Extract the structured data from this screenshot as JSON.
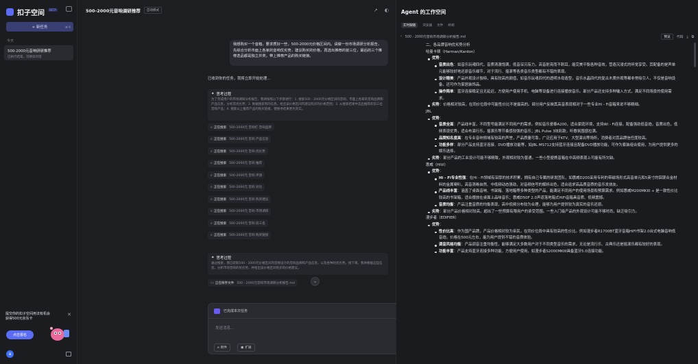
{
  "sidebar": {
    "app_name": "扣子空间",
    "beta": "BETA",
    "new_task": "+ 新任务",
    "new_task_kbd": "⌘ K",
    "section_today": "今天",
    "task_title": "500-2000元音响研研推荐",
    "task_subtitle": "已执行结束，可继续对话",
    "promo_text": "提交你的扣子空间用法有机会获得500元京东卡",
    "promo_button": "点击报名",
    "avatar": "a"
  },
  "chat": {
    "title": "500-2000元音响调研推荐",
    "mode_badge": "自动模式",
    "user_message": "我想购买一个音箱，要求质好一些，500-2000元价格区间内。请做一份市场调研分析报告，先综合分析市面上各家的音响优劣势，建议购买的价格，再选出推荐的前三位，最后的三个推荐选品都是独立并类，带上推荐产品的购买链接。",
    "reply": "已收到你的任务，我将立即开始处理...",
    "think1_title": "思考过程",
    "think1_body": "为了完成用户的市场调研分析报告，我将按照以下步骤进行：1. 搜索500 - 2000元价格区间的音响，市面上各家的音响品牌和产品信息，分析其优劣势；2. 根据搜索到的信息，给出该价格区间内建议购买的价格范围；3. 从搜索结果中选出推荐的前三位音响产品；4. 搜索以上推荐产品的购买链接，使搜寻结果更为充实。",
    "search_label": "正在搜索",
    "searches": [
      "500-2000元 音响打 音响品牌",
      "500-2000元 音响 产品信息",
      "500-2000元 音响 优劣势",
      "500-2000元 音响 推荐",
      "500-2000元 音响 评测",
      "500-2000元 音响 对比",
      "500-2000元 音响 购买建议",
      "500-2000元 音响 市场调研",
      "500-2000元 音响 前三名",
      "500-2000元 音响 购买链接"
    ],
    "think2_title": "思考过程",
    "think2_body": "通过搜索，我已获取500 - 2000元价格区间内音频设计的音响品牌和产品信息，以及各种的优劣势。接下来，我将根据这些信息，分析市场音响的优劣势，并给出该价格区间购买的价格建议。",
    "save_label": "正在保存文件",
    "save_file": "500 - 2000元音响市场调研分析报告.md",
    "status": "已完成本次任务",
    "input_placeholder": "发送消息...",
    "attach_label": "附件",
    "extend_label": "扩展"
  },
  "agent": {
    "title": "Agent 的工作空间",
    "tabs": [
      "实时跟随",
      "浏览器",
      "文件",
      "终端"
    ],
    "file_name": "500 - 2000元音响市场调研分析报告.md",
    "preview_label": "预览",
    "code_label": "代码",
    "doc": [
      {
        "lv": 0,
        "t": "二、各品牌音响优劣势分析"
      },
      {
        "lv": 0,
        "t": "哈曼卡顿（Harman/Kardon）"
      },
      {
        "lv": 1,
        "b": "优势",
        "t": "："
      },
      {
        "lv": 2,
        "b": "音质出色",
        "t": "：如音乐玩魂四代，音质清澈饱满，低音深沉有力，高音射亮而不刺耳，能完美平衡各种音效，营造沉浸式的听觉享受。其配备的是声单元能够较好地还原音乐细节，对于流行、摇滚等各类音乐类型都有不错的表现。"
      },
      {
        "lv": 2,
        "b": "设计精美",
        "t": "：产品外观设计独特，具有较高的颜值，如音乐玩魂四代的透明水母造型，音乐水晶四代的复古木质外观等都非常吸引人，不仅是音响设备，还可作为家居装饰品。"
      },
      {
        "lv": 2,
        "b": "操作简单",
        "t": "：蓝牙连接稳定且无延迟，方便用户使用手机、电脑等设备进行连接播放音乐。部分产品还支持多种输入方式，满足不同场景的使用需求。"
      },
      {
        "lv": 1,
        "b": "劣势",
        "t": "：价格相对较高，在同价位段中可能性价比不是最高的。部分用户反映其高音表现相对于一些专业Hi - Fi音箱来说不够精细。"
      },
      {
        "lv": 0,
        "t": "JBL"
      },
      {
        "lv": 1,
        "b": "优势",
        "t": "："
      },
      {
        "lv": 2,
        "b": "音质全面",
        "t": "：产品线丰富，不同型号能满足不同用户的需求。例如音乐瓷泰A200，适合家庭环境，支持Wi - Fi连接，配备强劲低音炮，音质出色，低频表现优秀，适合布演行乐。摇滚乐等节奏感较强的音乐；JBL Pulse 3炫彩款，听歌氛围感拉满。"
      },
      {
        "lv": 2,
        "b": "品牌知名度高",
        "t": "：在专业音响领域有较高的声誉，产品质量可靠，广泛应用于KTV、大型演出等场所，消费者对其品牌信任度较高。"
      },
      {
        "lv": 2,
        "b": "功能多样",
        "t": "：部分产品支持蓝牙连接、DVD播放功能等，如JBL MS712支持蓝牙连接且配备DVD播放功能，可作为套装组合使用，为用户提供更多的娱乐选择。"
      },
      {
        "lv": 1,
        "b": "劣势",
        "t": "：部分产品的工业设计可能不够精致，外观相对较为普通。一些小型便携音箱在中高频表现上可能有所欠缺。"
      },
      {
        "lv": 0,
        "t": "惠威（HiVi）"
      },
      {
        "lv": 1,
        "b": "优势",
        "t": "："
      },
      {
        "lv": 2,
        "b": "Hi - Fi专业性强",
        "t": "：在Hi - Fi领域有深厚的技术积累，拥有自己专属的研发团队，如惠威D200采用专利的带磁场形式高音单元和5英寸的铝镁合金材料的金属喇叭，高音清晰自然、中低频动态强劲，对音频信号的解析出色，适合追求高品质音质的音乐发烧友。"
      },
      {
        "lv": 2,
        "b": "产品线丰富",
        "t": "：涵盖了桌面音响、书架箱、落地箱等多种类型的产品，能满足不同用户的使用场景和预算需求。例如惠威M200MKIII + 是一款性价比较高的书架箱，适合摆放在桌面上品味音乐；惠威D50F 2.0声道落地箱式HiFi音箱具音质、低频震撼。"
      },
      {
        "lv": 2,
        "b": "音质均衡",
        "t": "：产品注重音质的均衡表现，高中低频分布较为合理，能够为用户提供较为真实的音乐还原。"
      },
      {
        "lv": 1,
        "b": "劣势",
        "t": "：部分产品价格相对较高，超出了一些预算有限用户的承受范围。一些入门级产品的外观设计可能不够时尚，缺乏吸引力。"
      },
      {
        "lv": 0,
        "t": "漫步者（EDIFIER）"
      },
      {
        "lv": 1,
        "b": "优势",
        "t": "："
      },
      {
        "lv": 2,
        "b": "性价比高",
        "t": "：作为国产品牌，产品价格相对较为亲民，在同价位段中具有较高的性价比。例如漫步者R1700BT蓝牙音箱HIFI书架2.0台式电脑音响低音炮，价格在500元左右，能为用户提供不错的音质体验。"
      },
      {
        "lv": 2,
        "b": "调音风格均衡",
        "t": "：产品调音注重均衡性，能够满足大多数用户对于不同类型音乐的需求，无论是流行乐、古典乐还是摇滚乐都有较好的表现。"
      },
      {
        "lv": 2,
        "b": "功能丰富",
        "t": "：产品支持蓝牙连接多种功能，方便用户使用，如漫步者S2000MKIII具备蓝牙5.0连接功能。"
      }
    ]
  }
}
